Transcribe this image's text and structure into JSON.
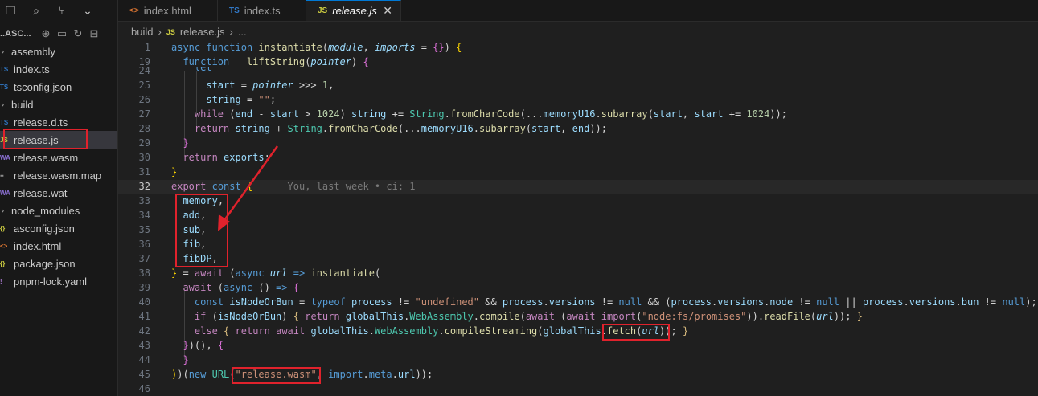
{
  "activity": [
    "files-icon",
    "search-icon",
    "source-control-icon",
    "chevron-down-icon"
  ],
  "explorer": {
    "title": "..ASC...",
    "items": [
      {
        "label": "assembly",
        "type": "folder",
        "icon": "›",
        "color": "#c5c5c5"
      },
      {
        "label": "index.ts",
        "type": "file",
        "icon": "TS",
        "color": "#3178c6"
      },
      {
        "label": "tsconfig.json",
        "type": "file",
        "icon": "TS",
        "color": "#3178c6"
      },
      {
        "label": "build",
        "type": "folder",
        "icon": "›",
        "color": "#c5c5c5"
      },
      {
        "label": "release.d.ts",
        "type": "file",
        "icon": "TS",
        "color": "#3178c6"
      },
      {
        "label": "release.js",
        "type": "file",
        "icon": "JS",
        "color": "#cbcb41"
      },
      {
        "label": "release.wasm",
        "type": "file",
        "icon": "WA",
        "color": "#8a6fd1"
      },
      {
        "label": "release.wasm.map",
        "type": "file",
        "icon": "≡",
        "color": "#cccccc"
      },
      {
        "label": "release.wat",
        "type": "file",
        "icon": "WA",
        "color": "#8a6fd1"
      },
      {
        "label": "node_modules",
        "type": "folder",
        "icon": "›",
        "color": "#c5c5c5"
      },
      {
        "label": "asconfig.json",
        "type": "file",
        "icon": "{}",
        "color": "#cbcb41"
      },
      {
        "label": "index.html",
        "type": "file",
        "icon": "<>",
        "color": "#e37933"
      },
      {
        "label": "package.json",
        "type": "file",
        "icon": "{}",
        "color": "#cbcb41"
      },
      {
        "label": "pnpm-lock.yaml",
        "type": "file",
        "icon": "!",
        "color": "#a074c4"
      }
    ]
  },
  "tabs": [
    {
      "label": "index.html",
      "icon": "<>",
      "color": "#e37933"
    },
    {
      "label": "index.ts",
      "icon": "TS",
      "color": "#3178c6"
    },
    {
      "label": "release.js",
      "icon": "JS",
      "color": "#cbcb41",
      "active": true
    }
  ],
  "breadcrumb": {
    "folder": "build",
    "sep": "›",
    "file": "release.js",
    "tail": "..."
  },
  "editor": {
    "line_numbers": [
      "1",
      "19",
      "24",
      "25",
      "26",
      "27",
      "28",
      "29",
      "30",
      "31",
      "32",
      "33",
      "34",
      "35",
      "36",
      "37",
      "38",
      "39",
      "40",
      "41",
      "42",
      "43",
      "44",
      "45",
      "46"
    ],
    "blame": "You, last week • ci: 1"
  }
}
